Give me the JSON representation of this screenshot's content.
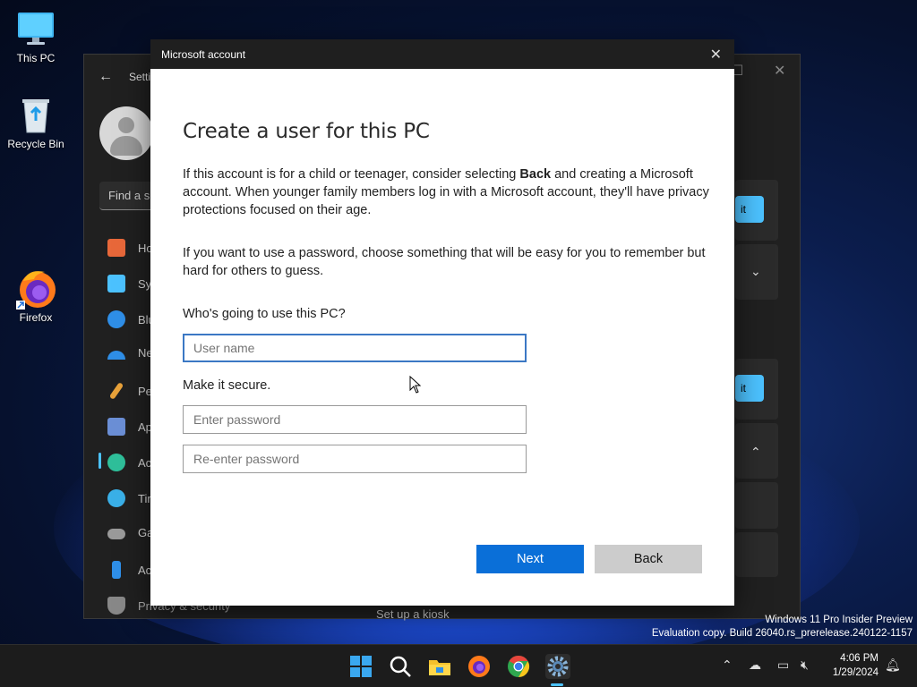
{
  "desktop": {
    "icons": [
      {
        "label": "This PC"
      },
      {
        "label": "Recycle Bin"
      },
      {
        "label": "Firefox"
      }
    ]
  },
  "settings_window": {
    "title_partial": "Setti",
    "search_placeholder_partial": "Find a s",
    "nav_items": [
      {
        "label": "Ho",
        "color": "#e8683a"
      },
      {
        "label": "Sy",
        "color": "#4cc2ff"
      },
      {
        "label": "Blu",
        "color": "#2f8fe8"
      },
      {
        "label": "Ne",
        "color": "#2f8fe8"
      },
      {
        "label": "Pe",
        "color": "#e8a23a"
      },
      {
        "label": "Ap",
        "color": "#6b8fd6"
      },
      {
        "label": "Ac",
        "color": "#2fbf9a"
      },
      {
        "label": "Tir",
        "color": "#3ab0e8"
      },
      {
        "label": "Ga",
        "color": "#9a9a9a"
      },
      {
        "label": "Ac",
        "color": "#2f8fe8"
      },
      {
        "label": "Privacy & security",
        "color": "#888888"
      }
    ],
    "button1_partial": "it",
    "button2_partial": "it",
    "kiosk_label": "Set up a kiosk"
  },
  "dialog": {
    "window_title": "Microsoft account",
    "heading": "Create a user for this PC",
    "para1_prefix": "If this account is for a child or teenager, consider selecting ",
    "para1_bold": "Back",
    "para1_suffix": " and creating a Microsoft account. When younger family members log in with a Microsoft account, they'll have privacy protections focused on their age.",
    "para2": "If you want to use a password, choose something that will be easy for you to remember but hard for others to guess.",
    "who_label": "Who's going to use this PC?",
    "username_placeholder": "User name",
    "secure_label": "Make it secure.",
    "password_placeholder": "Enter password",
    "reenter_placeholder": "Re-enter password",
    "next_label": "Next",
    "back_label": "Back"
  },
  "watermark": {
    "line1": "Windows 11 Pro Insider Preview",
    "line2": "Evaluation copy. Build 26040.rs_prerelease.240122-1157"
  },
  "taskbar": {
    "time": "4:06 PM",
    "date": "1/29/2024"
  },
  "colors": {
    "accent": "#0a6fd8",
    "settings_accent": "#4cc2ff"
  }
}
